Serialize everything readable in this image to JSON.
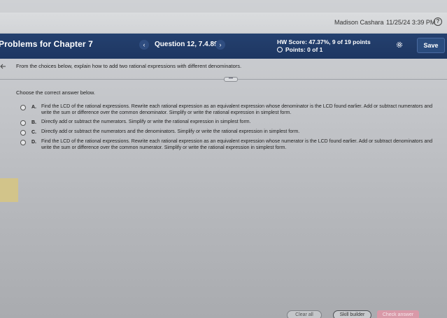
{
  "userbar": {
    "user_name": "Madison Cashara",
    "datetime": "11/25/24 3:39 PM",
    "help_icon": "?"
  },
  "header": {
    "chapter_title": "Problems for Chapter 7",
    "prev_glyph": "‹",
    "question_label": "Question 12, 7.4.89",
    "next_glyph": "›",
    "hw_score": "HW Score: 47.37%, 9 of 19 points",
    "points": "Points: 0 of 1",
    "save_label": "Save"
  },
  "question": {
    "instruction": "From the choices below, explain how to add two rational expressions with different denominators.",
    "more_glyph": "•••",
    "choose_label": "Choose the correct answer below.",
    "options": [
      {
        "letter": "A.",
        "text": "Find the LCD of the rational expressions. Rewrite each rational expression as an equivalent expression whose denominator is the LCD found earlier. Add or subtract numerators and write the sum or difference over the common denominator. Simplify or write the rational expression in simplest form."
      },
      {
        "letter": "B.",
        "text": "Directly add or subtract the numerators. Simplify or write the rational expression in simplest form."
      },
      {
        "letter": "C.",
        "text": "Directly add or subtract the numerators and the denominators. Simplify or write the rational expression in simplest form."
      },
      {
        "letter": "D.",
        "text": "Find the LCD of the rational expressions. Rewrite each rational expression as an equivalent expression whose numerator is the LCD found earlier. Add or subtract denominators and write the sum or difference over the common numerator. Simplify or write the rational expression in simplest form."
      }
    ]
  },
  "footer": {
    "clear_all_label": "Clear all",
    "skill_builder_label": "Skill builder",
    "check_answer_label": "Check answer"
  },
  "colors": {
    "header_bg": "#24406f",
    "check_answer_bg": "#d999a8"
  },
  "icons": {
    "back": "left-arrow-icon",
    "settings": "gear-icon",
    "help": "question-circle-icon"
  }
}
